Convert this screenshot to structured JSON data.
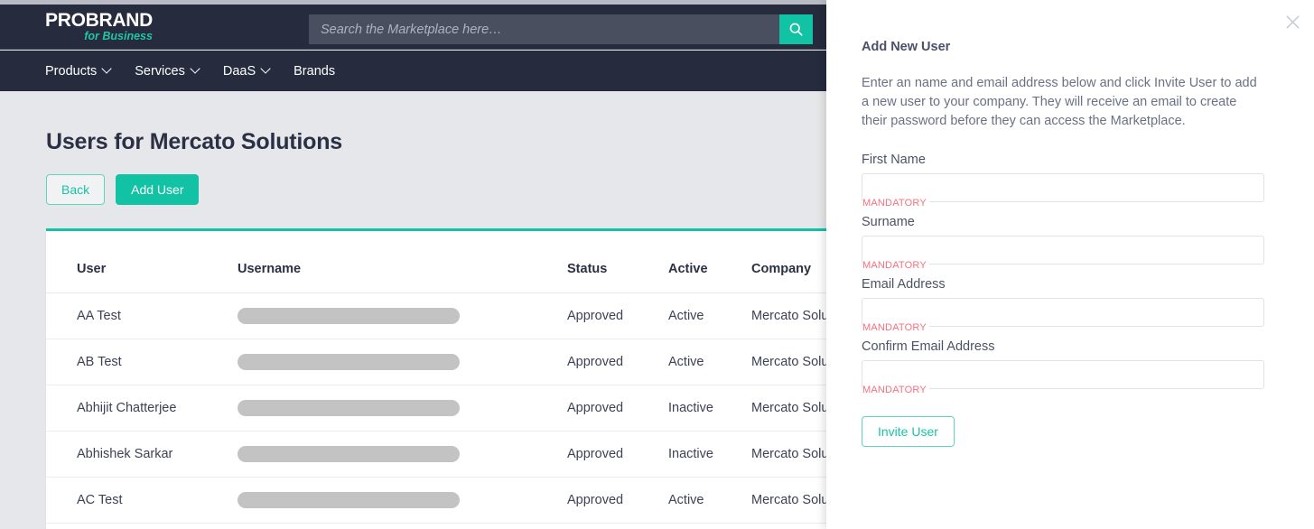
{
  "header": {
    "logo_main": "PROBRAND",
    "logo_sub": "for Business",
    "search_placeholder": "Search the Marketplace here…",
    "search_value": "",
    "search_icon": "search-icon",
    "accent_color": "#12c2a4",
    "header_bg": "#262b3d"
  },
  "nav": {
    "items": [
      {
        "label": "Products",
        "has_chevron": true
      },
      {
        "label": "Services",
        "has_chevron": true
      },
      {
        "label": "DaaS",
        "has_chevron": true
      },
      {
        "label": "Brands",
        "has_chevron": false
      }
    ]
  },
  "main": {
    "page_title": "Users for Mercato Solutions",
    "back_label": "Back",
    "add_user_label": "Add User",
    "table": {
      "columns": [
        "User",
        "Username",
        "Status",
        "Active",
        "Company"
      ],
      "rows": [
        {
          "user": "AA Test",
          "username": "",
          "username_redacted": true,
          "status": "Approved",
          "active": "Active",
          "company": "Mercato Solutions"
        },
        {
          "user": "AB Test",
          "username": "",
          "username_redacted": true,
          "status": "Approved",
          "active": "Active",
          "company": "Mercato Solutions"
        },
        {
          "user": "Abhijit Chatterjee",
          "username": "",
          "username_redacted": true,
          "status": "Approved",
          "active": "Inactive",
          "company": "Mercato Solutions"
        },
        {
          "user": "Abhishek Sarkar",
          "username": "",
          "username_redacted": true,
          "status": "Approved",
          "active": "Inactive",
          "company": "Mercato Solutions"
        },
        {
          "user": "AC Test",
          "username": "",
          "username_redacted": true,
          "status": "Approved",
          "active": "Active",
          "company": "Mercato Solutions"
        }
      ]
    }
  },
  "panel": {
    "title": "Add New User",
    "description": "Enter an name and email address below and click Invite User to add a new user to your company. They will receive an email to create their password before they can access the Marketplace.",
    "close_icon": "close-icon",
    "mandatory_label": "MANDATORY",
    "mandatory_color": "#f4717f",
    "fields": [
      {
        "label": "First Name",
        "value": "",
        "placeholder": "",
        "mandatory": "MANDATORY"
      },
      {
        "label": "Surname",
        "value": "",
        "placeholder": "",
        "mandatory": "MANDATORY"
      },
      {
        "label": "Email Address",
        "value": "",
        "placeholder": "",
        "mandatory": "MANDATORY"
      },
      {
        "label": "Confirm Email Address",
        "value": "",
        "placeholder": "",
        "mandatory": "MANDATORY"
      }
    ],
    "invite_label": "Invite User"
  }
}
